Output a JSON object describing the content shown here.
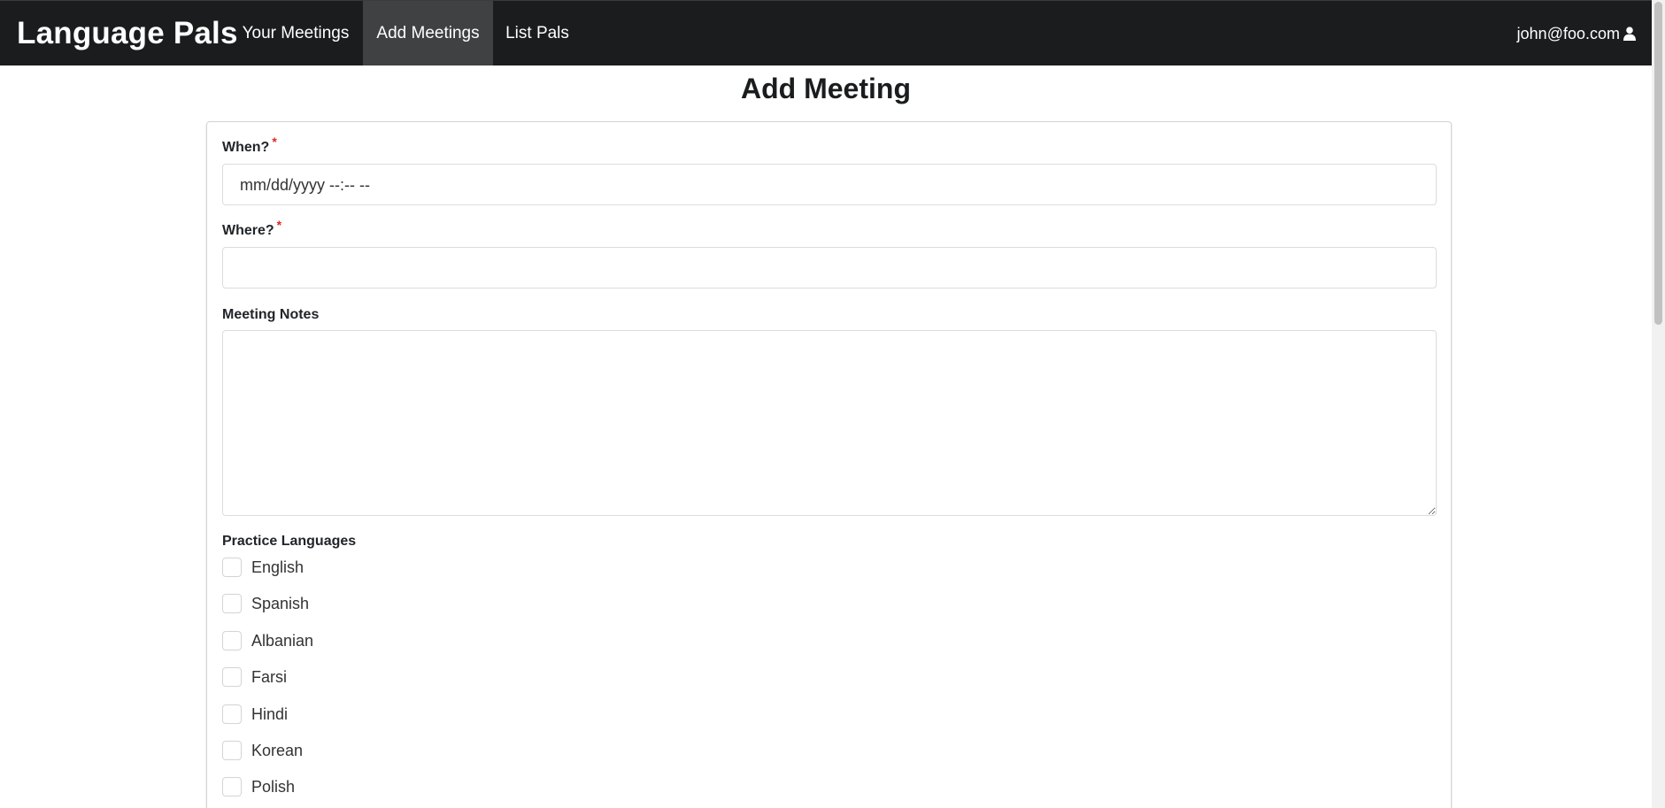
{
  "navbar": {
    "brand": "Language Pals",
    "items": [
      {
        "label": "Your Meetings",
        "active": false
      },
      {
        "label": "Add Meetings",
        "active": true
      },
      {
        "label": "List Pals",
        "active": false
      }
    ],
    "user_email": "john@foo.com",
    "user_icon": "user-icon"
  },
  "page": {
    "title": "Add Meeting"
  },
  "form": {
    "when_label": "When?",
    "when_value": "mm/dd/yyyy --:-- --",
    "where_label": "Where?",
    "where_value": "",
    "notes_label": "Meeting Notes",
    "notes_value": "",
    "required_marker": "*",
    "languages_label": "Practice Languages",
    "languages": [
      "English",
      "Spanish",
      "Albanian",
      "Farsi",
      "Hindi",
      "Korean",
      "Polish"
    ]
  },
  "colors": {
    "navbar_bg": "#1b1c1d",
    "active_tab_bg": "#404142",
    "required": "#db2828"
  }
}
